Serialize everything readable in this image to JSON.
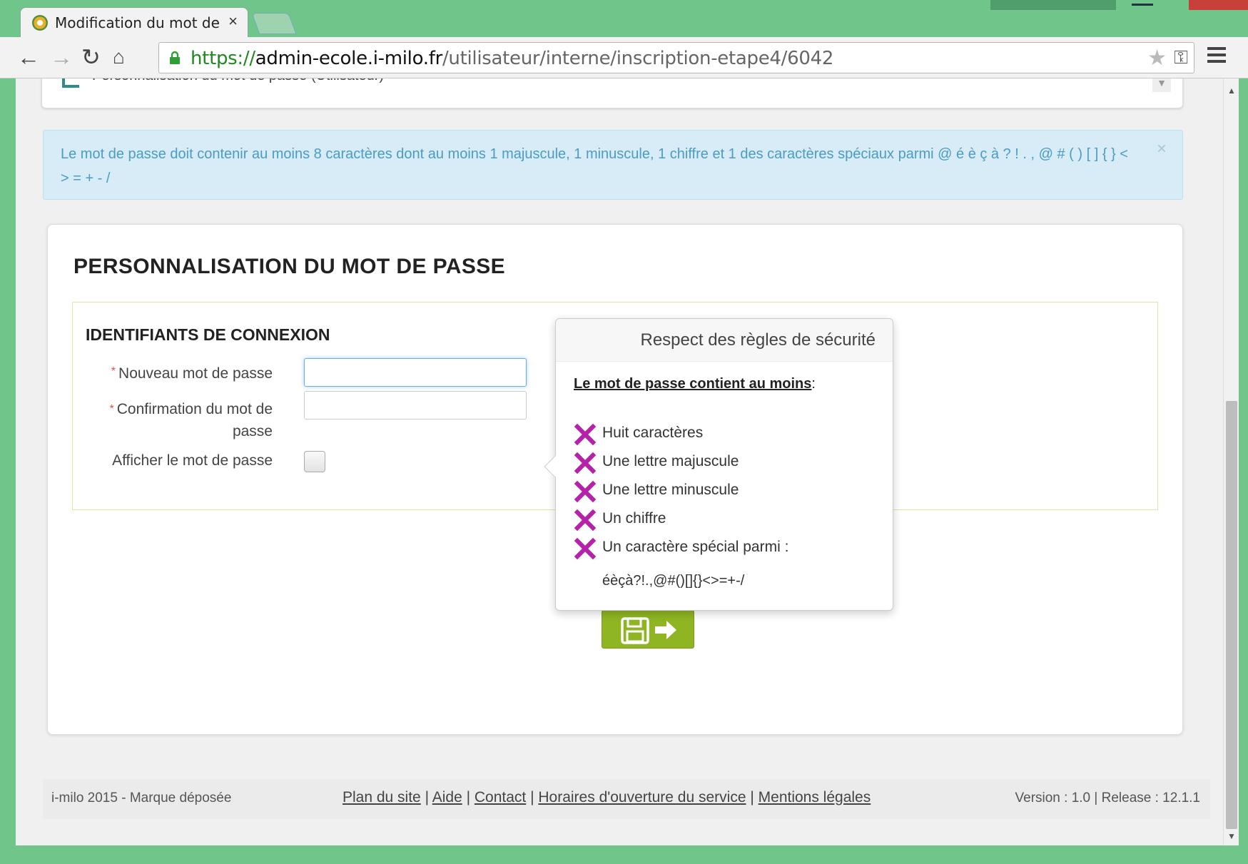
{
  "browser": {
    "tab_title": "Modification du mot de p",
    "url_scheme": "https://",
    "url_host": "admin-ecole.i-milo.fr",
    "url_path": "/utilisateur/interne/inscription-etape4/6042"
  },
  "page": {
    "collapsed_panel_title": "Personnalisation du mot de passe (Utilisateur)",
    "alert_text": "Le mot de passe doit contenir au moins 8 caractères dont au moins 1 majuscule, 1 minuscule, 1 chiffre et 1 des caractères spéciaux parmi @ é è ç à ? ! . , @ # ( ) [ ] { } < > = + - /",
    "alert_close": "×",
    "card_title": "PERSONNALISATION DU MOT DE PASSE",
    "section_title": "IDENTIFIANTS DE CONNEXION",
    "required_mark": "*",
    "new_password_label": "Nouveau mot de passe",
    "confirm_password_label": "Confirmation du mot de passe",
    "show_password_label": "Afficher le mot de passe",
    "new_password_value": "",
    "confirm_password_value": ""
  },
  "popover": {
    "title": "Respect des règles de sécurité",
    "subtitle": "Le mot de passe contient au moins",
    "subtitle_suffix": ":",
    "rules": [
      "Huit caractères",
      "Une lettre majuscule",
      "Une lettre minuscule",
      "Un chiffre",
      "Un caractère spécial parmi :"
    ],
    "special_chars": "éèçà?!.,@#()[]{}<>=+-/"
  },
  "footer": {
    "left": "i-milo 2015 - Marque déposée",
    "links": [
      "Plan du site",
      "Aide",
      "Contact",
      "Horaires d'ouverture du service",
      "Mentions légales"
    ],
    "separator": " | ",
    "right": "Version : 1.0 | Release : 12.1.1"
  },
  "colors": {
    "window_frame": "#6fc58a",
    "alert_bg": "#d7ecf6",
    "alert_text": "#4a9cc6",
    "save_button": "#8fb523",
    "fail_icon": "#b521a8"
  },
  "icons": [
    "tab-favicon-icon",
    "back-icon",
    "forward-icon",
    "reload-icon",
    "home-icon",
    "lock-icon",
    "star-icon",
    "key-icon",
    "menu-icon",
    "save-icon",
    "arrow-right-icon",
    "cross-icon"
  ]
}
